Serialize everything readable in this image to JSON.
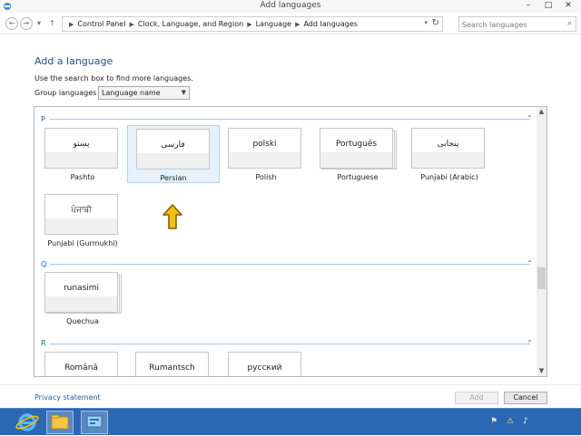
{
  "window": {
    "title": "Add languages",
    "minimize": "–",
    "maximize": "□",
    "close": "✕"
  },
  "address": {
    "crumbs": [
      "Control Panel",
      "Clock, Language, and Region",
      "Language",
      "Add languages"
    ],
    "search_placeholder": "Search languages"
  },
  "main": {
    "heading": "Add a language",
    "hint": "Use the search box to find more languages.",
    "group_label": "Group languages by:",
    "group_value": "Language name"
  },
  "groups": [
    {
      "letter": "P",
      "languages": [
        {
          "native": "پښتو",
          "name": "Pashto",
          "stacked": false,
          "selected": false
        },
        {
          "native": "فارسی",
          "name": "Persian",
          "stacked": false,
          "selected": true
        },
        {
          "native": "polski",
          "name": "Polish",
          "stacked": false,
          "selected": false
        },
        {
          "native": "Português",
          "name": "Portuguese",
          "stacked": true,
          "selected": false
        },
        {
          "native": "پنجابی",
          "name": "Punjabi (Arabic)",
          "stacked": false,
          "selected": false
        },
        {
          "native": "ਪੰਜਾਬੀ",
          "name": "Punjabi (Gurmukhi)",
          "stacked": false,
          "selected": false
        }
      ]
    },
    {
      "letter": "Q",
      "languages": [
        {
          "native": "runasimi",
          "name": "Quechua",
          "stacked": true,
          "selected": false
        }
      ]
    },
    {
      "letter": "R",
      "languages": [
        {
          "native": "Română",
          "name": "",
          "stacked": false,
          "selected": false
        },
        {
          "native": "Rumantsch",
          "name": "",
          "stacked": false,
          "selected": false
        },
        {
          "native": "русский",
          "name": "",
          "stacked": false,
          "selected": false
        }
      ]
    }
  ],
  "footer": {
    "privacy": "Privacy statement",
    "add": "Add",
    "cancel": "Cancel"
  },
  "colors": {
    "accent": "#1f5fa8",
    "selected_bg": "#e5f1fb",
    "taskbar": "#2b67b3",
    "hint_arrow": "#f2c200"
  }
}
